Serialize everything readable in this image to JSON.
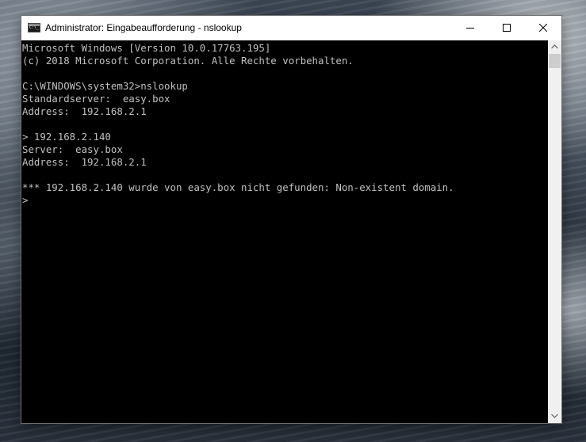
{
  "window": {
    "title": "Administrator: Eingabeaufforderung - nslookup",
    "icon": "command-prompt-icon",
    "controls": [
      "minimize-icon",
      "maximize-icon",
      "close-icon"
    ]
  },
  "console": {
    "background": "#000000",
    "foreground": "#c0c0c0",
    "lines": [
      "Microsoft Windows [Version 10.0.17763.195]",
      "(c) 2018 Microsoft Corporation. Alle Rechte vorbehalten.",
      "",
      "C:\\WINDOWS\\system32>nslookup",
      "Standardserver:  easy.box",
      "Address:  192.168.2.1",
      "",
      "> 192.168.2.140",
      "Server:  easy.box",
      "Address:  192.168.2.1",
      "",
      "*** 192.168.2.140 wurde von easy.box nicht gefunden: Non-existent domain.",
      ">"
    ]
  },
  "scrollbar": {
    "up_icon": "scroll-up-arrow-icon",
    "down_icon": "scroll-down-arrow-icon"
  }
}
